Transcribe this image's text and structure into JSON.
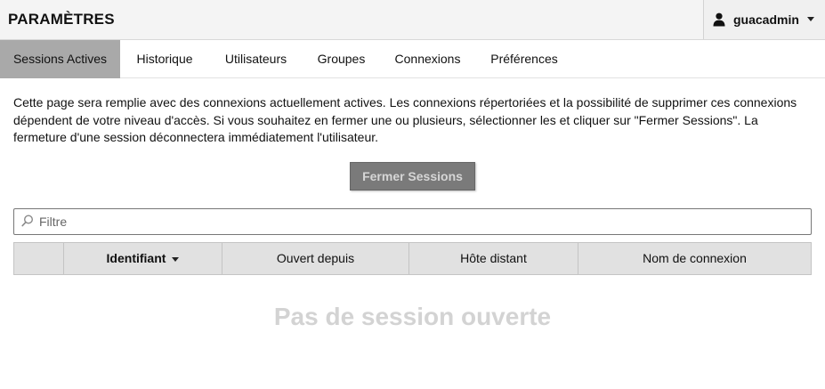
{
  "header": {
    "title": "PARAMÈTRES",
    "user_name": "guacadmin",
    "user_icon": "user-icon"
  },
  "tabs": [
    {
      "label": "Sessions Actives",
      "active": true
    },
    {
      "label": "Historique",
      "active": false
    },
    {
      "label": "Utilisateurs",
      "active": false
    },
    {
      "label": "Groupes",
      "active": false
    },
    {
      "label": "Connexions",
      "active": false
    },
    {
      "label": "Préférences",
      "active": false
    }
  ],
  "description": "Cette page sera remplie avec des connexions actuellement actives. Les connexions répertoriées et la possibilité de supprimer ces connexions dépendent de votre niveau d'accès. Si vous souhaitez en fermer une ou plusieurs, sélectionner les et cliquer sur \"Fermer Sessions\". La fermeture d'une session déconnectera immédiatement l'utilisateur.",
  "actions": {
    "close_sessions_label": "Fermer Sessions"
  },
  "filter": {
    "placeholder": "Filtre",
    "value": ""
  },
  "table": {
    "columns": [
      "",
      "Identifiant",
      "Ouvert depuis",
      "Hôte distant",
      "Nom de connexion"
    ],
    "sorted_column": "Identifiant",
    "rows": []
  },
  "empty_message": "Pas de session ouverte",
  "colors": {
    "active_tab": "#a9a9a9",
    "button_bg": "#7a7a7a",
    "table_header_bg": "#e1e1e1",
    "empty_text": "#d3d3d3"
  }
}
